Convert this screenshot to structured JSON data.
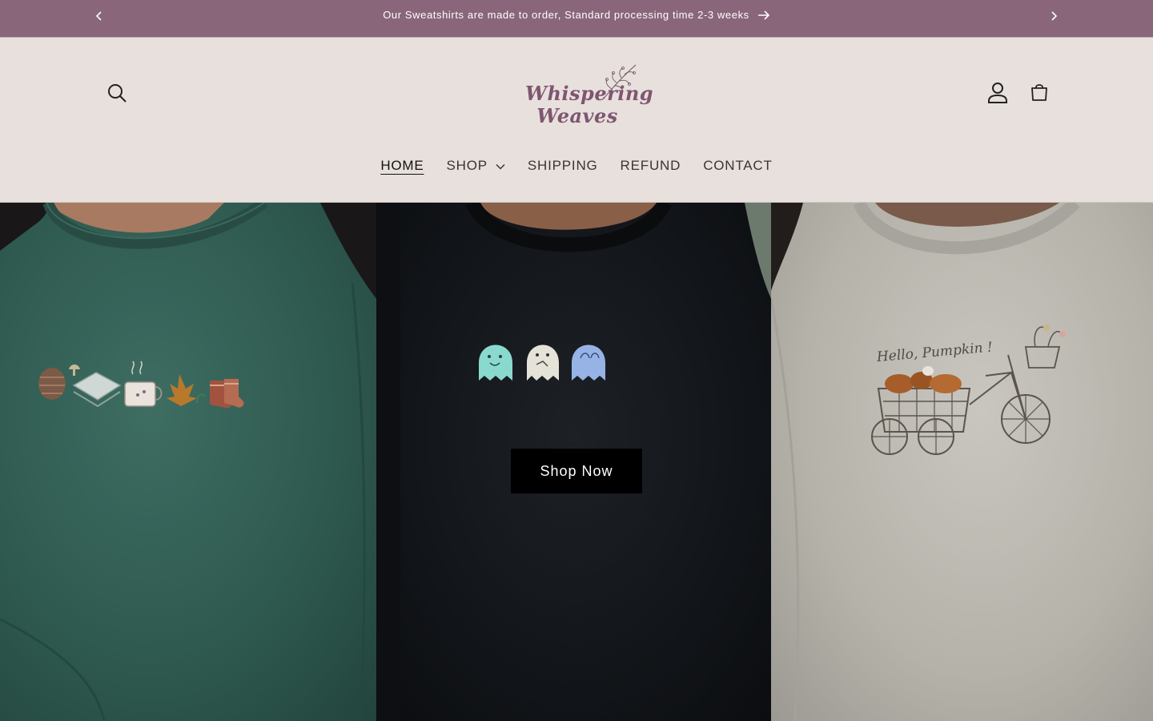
{
  "announcement": {
    "message": "Our Sweatshirts are made to order, Standard processing time 2-3 weeks",
    "prev_icon": "chevron-left-icon",
    "next_icon": "chevron-right-icon",
    "link_icon": "arrow-right-icon"
  },
  "header": {
    "logo": {
      "line1": "Whispering",
      "line2": "Weaves"
    },
    "icons": {
      "search": "search-icon",
      "account": "user-icon",
      "cart": "cart-icon"
    }
  },
  "nav": {
    "items": [
      {
        "label": "HOME",
        "active": true
      },
      {
        "label": "SHOP",
        "has_dropdown": true
      },
      {
        "label": "SHIPPING"
      },
      {
        "label": "REFUND"
      },
      {
        "label": "CONTACT"
      }
    ]
  },
  "hero": {
    "cta_label": "Shop Now",
    "panels": [
      {
        "shirt_color": "#2f5a50"
      },
      {
        "shirt_color": "#121519"
      },
      {
        "shirt_color": "#b5b2aa",
        "embroidery_text": "Hello, Pumpkin !"
      }
    ]
  },
  "colors": {
    "announcement_bg": "#896679",
    "header_bg": "#e8e0dc",
    "logo": "#7e5670",
    "cta_bg": "#000000"
  }
}
